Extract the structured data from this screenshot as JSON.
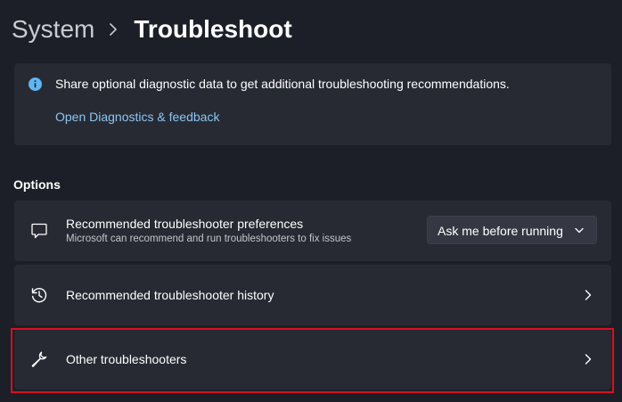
{
  "breadcrumb": {
    "parent": "System",
    "current": "Troubleshoot"
  },
  "info_card": {
    "icon": "info-icon",
    "text": "Share optional diagnostic data to get additional troubleshooting recommendations.",
    "link": "Open Diagnostics & feedback"
  },
  "options": {
    "heading": "Options",
    "items": [
      {
        "icon": "chat-bubble-icon",
        "title": "Recommended troubleshooter preferences",
        "subtitle": "Microsoft can recommend and run troubleshooters to fix issues",
        "dropdown_value": "Ask me before running"
      },
      {
        "icon": "history-icon",
        "title": "Recommended troubleshooter history"
      },
      {
        "icon": "wrench-icon",
        "title": "Other troubleshooters"
      }
    ]
  },
  "colors": {
    "background": "#1c1f28",
    "card": "#272a33",
    "link": "#8cc6f2",
    "info_icon": "#60b6f0",
    "highlight": "#d9101d"
  }
}
